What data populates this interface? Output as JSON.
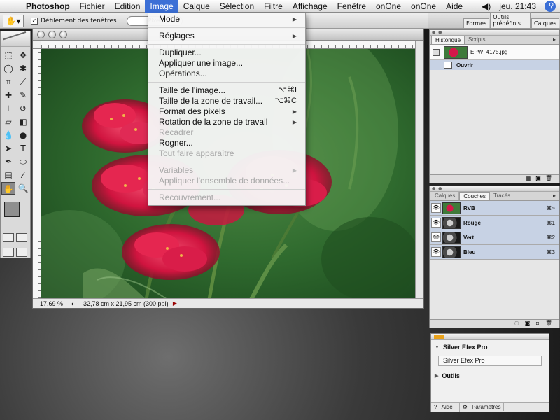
{
  "menubar": {
    "app": "Photoshop",
    "items": [
      "Fichier",
      "Edition",
      "Image",
      "Calque",
      "Sélection",
      "Filtre",
      "Affichage",
      "Fenêtre",
      "onOne",
      "onOne",
      "Aide"
    ],
    "active_index": 2,
    "clock": "jeu. 21:43"
  },
  "optionsbar": {
    "checkbox_label": "Défilement des fenêtres",
    "pill_text": "Pixels",
    "dock_tabs": [
      "Formes",
      "Outils prédéfinis",
      "Calques"
    ]
  },
  "document": {
    "zoom": "17,69 %",
    "info": "32,78 cm x 21,95 cm (300 ppi)"
  },
  "image_menu": {
    "items": [
      {
        "label": "Mode",
        "shortcut": "",
        "submenu": true,
        "disabled": false
      },
      {
        "sep": true
      },
      {
        "label": "Réglages",
        "shortcut": "",
        "submenu": true,
        "disabled": false
      },
      {
        "sep": true
      },
      {
        "label": "Dupliquer...",
        "shortcut": "",
        "submenu": false,
        "disabled": false
      },
      {
        "label": "Appliquer une image...",
        "shortcut": "",
        "submenu": false,
        "disabled": false
      },
      {
        "label": "Opérations...",
        "shortcut": "",
        "submenu": false,
        "disabled": false
      },
      {
        "sep": true
      },
      {
        "label": "Taille de l'image...",
        "shortcut": "⌥⌘I",
        "submenu": false,
        "disabled": false
      },
      {
        "label": "Taille de la zone de travail...",
        "shortcut": "⌥⌘C",
        "submenu": false,
        "disabled": false
      },
      {
        "label": "Format des pixels",
        "shortcut": "",
        "submenu": true,
        "disabled": false
      },
      {
        "label": "Rotation de la zone de travail",
        "shortcut": "",
        "submenu": true,
        "disabled": false
      },
      {
        "label": "Recadrer",
        "shortcut": "",
        "submenu": false,
        "disabled": true
      },
      {
        "label": "Rogner...",
        "shortcut": "",
        "submenu": false,
        "disabled": false
      },
      {
        "label": "Tout faire apparaître",
        "shortcut": "",
        "submenu": false,
        "disabled": true
      },
      {
        "sep": true
      },
      {
        "label": "Variables",
        "shortcut": "",
        "submenu": true,
        "disabled": true
      },
      {
        "label": "Appliquer l'ensemble de données...",
        "shortcut": "",
        "submenu": false,
        "disabled": true
      },
      {
        "sep": true
      },
      {
        "label": "Recouvrement...",
        "shortcut": "",
        "submenu": false,
        "disabled": true
      }
    ]
  },
  "history_panel": {
    "tabs": [
      "Historique",
      "Scripts"
    ],
    "snapshot_name": "EPW_4175.jpg",
    "steps": [
      "Ouvrir"
    ]
  },
  "channels_panel": {
    "tabs": [
      "Calques",
      "Couches",
      "Tracés"
    ],
    "channels": [
      {
        "name": "RVB",
        "shortcut": "⌘~",
        "thumb": "rgb"
      },
      {
        "name": "Rouge",
        "shortcut": "⌘1",
        "thumb": "gray"
      },
      {
        "name": "Vert",
        "shortcut": "⌘2",
        "thumb": "gray"
      },
      {
        "name": "Bleu",
        "shortcut": "⌘3",
        "thumb": "gray"
      }
    ]
  },
  "silver_efex": {
    "title": "Silver Efex Pro",
    "field": "Silver Efex Pro",
    "section2": "Outils",
    "help": "Aide",
    "settings": "Paramètres"
  },
  "colors": {
    "menu_highlight": "#3b6fd6",
    "foreground": "#8f8f8f",
    "background": "#ffffff",
    "selected_row": "#c7d2e4"
  }
}
